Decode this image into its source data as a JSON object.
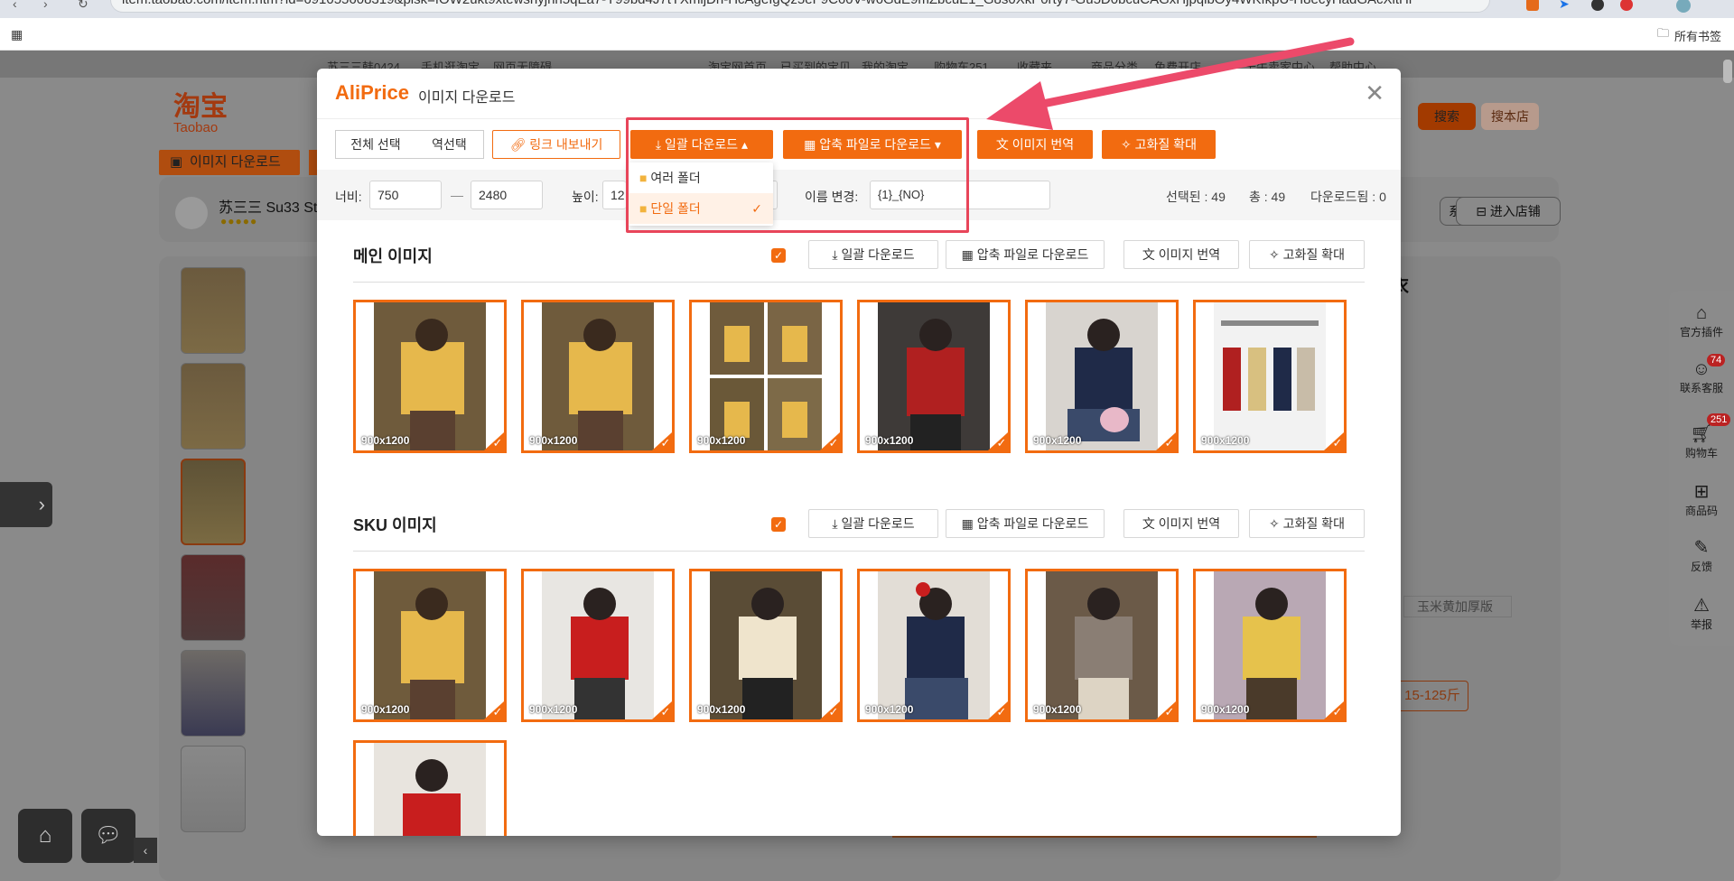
{
  "browser": {
    "url": "item.taobao.com/item.htm?id=691055608319&pisk=fOW2ukt9xtewshyjhh5qEa7-Y99bd4J7tYXmljDn-HcAgeIgQz5eF9C60V-w6GdE9mZbcuE1_G8s0XkP0rty7-Gu5D0bcuCAGxHjpqibOy4WKfkpU-H8ecyHadGAcXitHi",
    "bookmarks_label": "所有书签"
  },
  "taobao": {
    "nav": [
      "苏三三韩0424",
      "手机逛淘宝",
      "网页无障碍",
      "淘宝网首页",
      "已买到的宝贝",
      "我的淘宝",
      "购物车251",
      "收藏夹",
      "商品分类",
      "免费开店",
      "千牛卖家中心",
      "帮助中心"
    ],
    "logo_cn": "淘宝",
    "logo_en": "Taobao",
    "image_download_btn": "이미지 다운로드",
    "shop_name": "苏三三 Su33 St",
    "search_btn": "搜索",
    "search_shop_btn": "搜本店",
    "service_btn": "系客服",
    "enter_shop_btn": "进入店铺",
    "title_fragment": "衣",
    "variant": "玉米黄加厚版",
    "price_tag": "15-125斤",
    "sidebar": [
      {
        "label": "官方插件",
        "icon": "plugin-icon"
      },
      {
        "label": "联系客服",
        "icon": "service-icon",
        "badge": "74"
      },
      {
        "label": "购物车",
        "icon": "cart-icon",
        "badge": "251"
      },
      {
        "label": "商品码",
        "icon": "qrcode-icon"
      },
      {
        "label": "反馈",
        "icon": "feedback-icon"
      },
      {
        "label": "举报",
        "icon": "report-icon"
      }
    ]
  },
  "modal": {
    "brand": "AliPrice",
    "title": "이미지 다운로드",
    "toolbar": {
      "select_all": "전체 선택",
      "invert": "역선택",
      "export_links": "링크 내보내기",
      "batch_download": "일괄 다운로드",
      "zip_download": "압축 파일로 다운로드",
      "translate": "이미지 번역",
      "upscale": "고화질 확대"
    },
    "dropdown": {
      "items": [
        {
          "label": "여러 폴더",
          "selected": false
        },
        {
          "label": "단일 폴더",
          "selected": true
        }
      ]
    },
    "settings": {
      "width_label": "너비:",
      "width_min": "750",
      "width_sep": "—",
      "width_max": "2480",
      "height_label": "높이:",
      "height_min": "12",
      "rename_label": "이름 변경:",
      "rename_value": "{1}_{NO}",
      "selected": "선택된 : 49",
      "total": "총 : 49",
      "downloaded": "다운로드됨 : 0"
    },
    "sections": [
      {
        "title": "메인 이미지",
        "batch_download": "일괄 다운로드",
        "zip_download": "압축 파일로 다운로드",
        "translate": "이미지 번역",
        "upscale": "고화질 확대",
        "images": [
          "900x1200",
          "900x1200",
          "900x1200",
          "900x1200",
          "900x1200",
          "900x1200"
        ]
      },
      {
        "title": "SKU 이미지",
        "batch_download": "일괄 다운로드",
        "zip_download": "압축 파일로 다운로드",
        "translate": "이미지 번역",
        "upscale": "고화질 확대",
        "images": [
          "900x1200",
          "900x1200",
          "900x1200",
          "900x1200",
          "900x1200",
          "900x1200",
          ""
        ]
      }
    ]
  },
  "colors": {
    "accent": "#f26b10",
    "highlight": "#e8455a",
    "overlay": "#7a7a7a"
  }
}
